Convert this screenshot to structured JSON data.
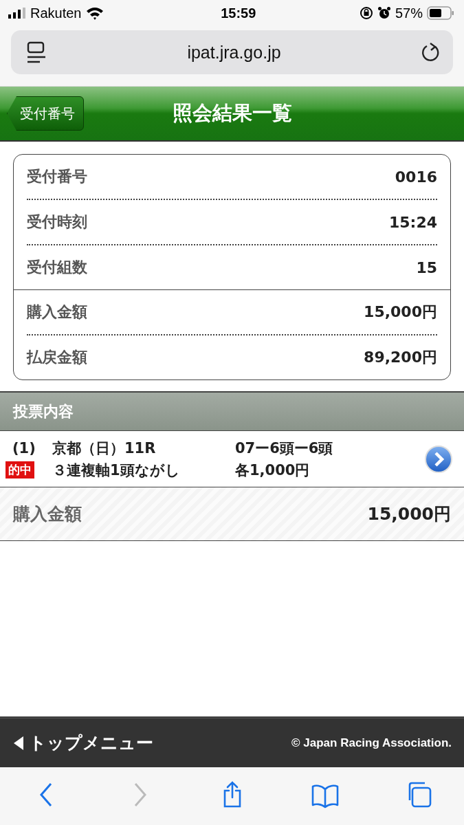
{
  "status_bar": {
    "carrier": "Rakuten",
    "time": "15:59",
    "battery": "57%"
  },
  "browser": {
    "url": "ipat.jra.go.jp"
  },
  "header": {
    "back_label": "受付番号",
    "title": "照会結果一覧"
  },
  "summary": {
    "groups": [
      [
        {
          "label": "受付番号",
          "value": "0016"
        },
        {
          "label": "受付時刻",
          "value": "15:24"
        },
        {
          "label": "受付組数",
          "value": "15"
        }
      ],
      [
        {
          "label": "購入金額",
          "value": "15,000円"
        },
        {
          "label": "払戻金額",
          "value": "89,200円"
        }
      ]
    ]
  },
  "section": {
    "title": "投票内容"
  },
  "bets": [
    {
      "number": "(1)",
      "race": "京都（日）11R",
      "combination": "07ー6頭ー6頭",
      "badge": "的中",
      "type": "３連複軸1頭ながし",
      "amount": "各1,000円"
    }
  ],
  "total": {
    "label": "購入金額",
    "value": "15,000円"
  },
  "footer": {
    "menu_link": "トップメニュー",
    "copyright": "© Japan Racing Association."
  },
  "toolbar": [
    {
      "kind": "back",
      "disabled": false
    },
    {
      "kind": "forward",
      "disabled": true
    },
    {
      "kind": "share",
      "disabled": false
    },
    {
      "kind": "bookmarks",
      "disabled": false
    },
    {
      "kind": "tabs",
      "disabled": false
    }
  ]
}
